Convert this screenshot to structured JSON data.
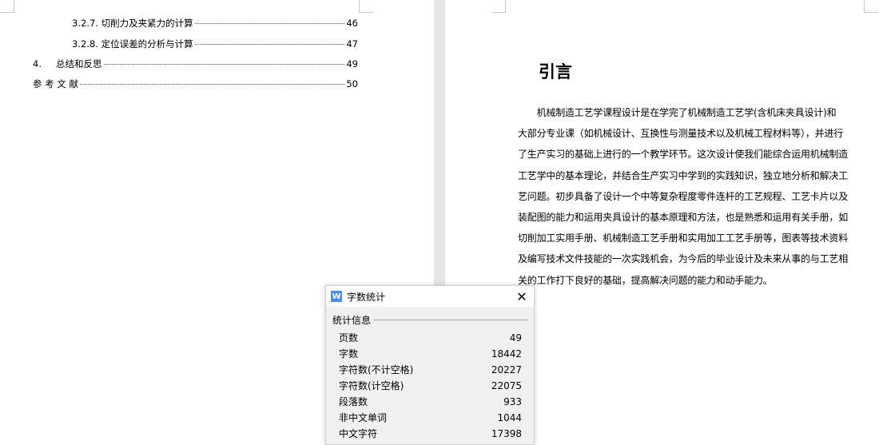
{
  "toc": [
    {
      "number": "3.2.7.",
      "title": "切削力及夹紧力的计算",
      "page": "46"
    },
    {
      "number": "3.2.8.",
      "title": "定位误差的分析与计算",
      "page": "47"
    },
    {
      "number": "4.",
      "title": "总结和反思",
      "page": "49"
    },
    {
      "number": "",
      "title": "参 考 文 献",
      "page": "50"
    }
  ],
  "heading": "引言",
  "paragraph_lines": [
    "　　机械制造工艺学课程设计是在学完了机械制造工艺学(含机床夹具设计)和",
    "大部分专业课（如机械设计、互换性与测量技术以及机械工程材料等），并进行",
    "了生产实习的基础上进行的一个教学环节。这次设计使我们能综合运用机械制造",
    "工艺学中的基本理论，并结合生产实习中学到的实践知识，独立地分析和解决工",
    "艺问题。初步具备了设计一个中等复杂程度零件连杆的工艺规程、工艺卡片以及",
    "装配图的能力和运用夹具设计的基本原理和方法，也是熟悉和运用有关手册，如",
    "切削加工实用手册、机械制造工艺手册和实用加工工艺手册等，图表等技术资料",
    "及编写技术文件技能的一次实践机会，为今后的毕业设计及未来从事的与工艺相",
    "关的工作打下良好的基础，提高解决问题的能力和动手能力。"
  ],
  "dialog": {
    "icon": "W",
    "title": "字数统计",
    "close": "✕",
    "group": "统计信息",
    "stats": [
      {
        "label": "页数",
        "value": "49"
      },
      {
        "label": "字数",
        "value": "18442"
      },
      {
        "label": "字符数(不计空格)",
        "value": "20227"
      },
      {
        "label": "字符数(计空格)",
        "value": "22075"
      },
      {
        "label": "段落数",
        "value": "933"
      },
      {
        "label": "非中文单词",
        "value": "1044"
      },
      {
        "label": "中文字符",
        "value": "17398"
      }
    ]
  }
}
